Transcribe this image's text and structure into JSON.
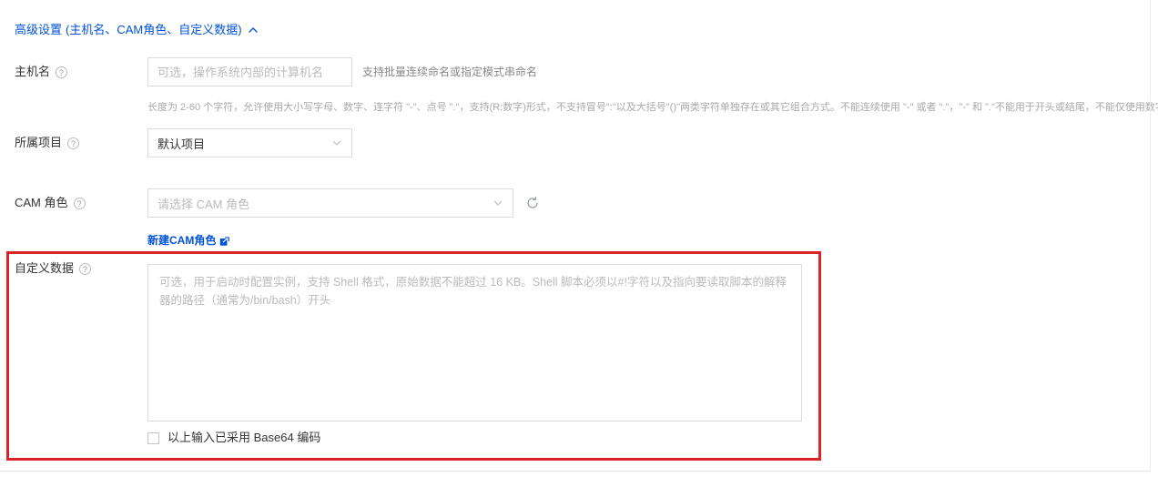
{
  "advanced": {
    "title_main": "高级设置",
    "title_sub": "(主机名、CAM角色、自定义数据)",
    "collapse_icon": "chevron-up-icon"
  },
  "hostname": {
    "label": "主机名",
    "help_icon": "?",
    "placeholder": "可选，操作系统内部的计算机名",
    "value": "",
    "side_hint": "支持批量连续命名或指定模式串命名",
    "rule_hint": "长度为 2-60 个字符，允许使用大小写字母、数字、连字符 \"-\"、点号 \".\"，支持(R:数字)形式，不支持冒号\":\"以及大括号\"()\"两类字符单独存在或其它组合方式。不能连续使用 \"-\" 或者 \".\"，\"-\" 和 \".\"不能用于开头或结尾，不能仅使用数字"
  },
  "project": {
    "label": "所属项目",
    "help_icon": "?",
    "selected": "默认项目",
    "options": [
      "默认项目"
    ],
    "caret_icon": "chevron-down-icon"
  },
  "cam_role": {
    "label": "CAM 角色",
    "help_icon": "?",
    "placeholder": "请选择 CAM 角色",
    "selected": "",
    "caret_icon": "chevron-down-icon",
    "refresh_icon": "refresh-icon",
    "link_label": "新建CAM角色",
    "link_icon": "external-link-icon"
  },
  "custom_data": {
    "label": "自定义数据",
    "help_icon": "?",
    "placeholder": "可选，用于启动时配置实例，支持 Shell 格式，原始数据不能超过 16 KB。Shell 脚本必须以#!字符以及指向要读取脚本的解释器的路径（通常为/bin/bash）开头",
    "value": "",
    "checkbox_label": "以上输入已采用 Base64 编码",
    "checkbox_checked": false
  },
  "colors": {
    "link": "#0052d9",
    "highlight_border": "#d9242a",
    "text": "#333333",
    "placeholder": "#bbbbbb",
    "hint": "#888888"
  }
}
